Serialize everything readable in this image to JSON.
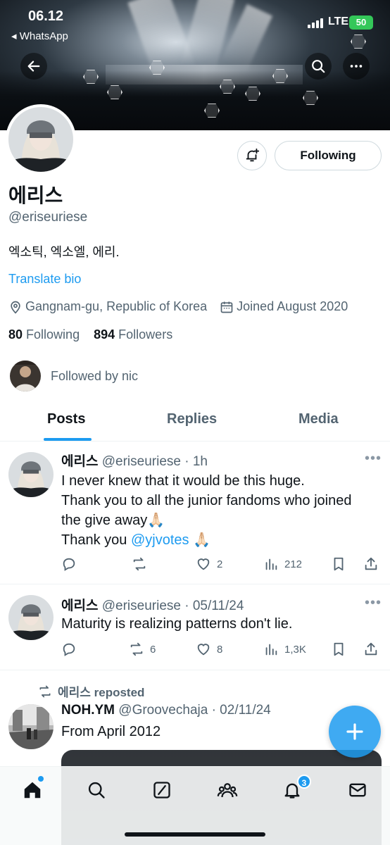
{
  "status_bar": {
    "time": "06.12",
    "back_app": "◂ WhatsApp",
    "network": "LTE",
    "battery": "50"
  },
  "profile": {
    "display_name": "에리스",
    "handle": "@eriseuriese",
    "bio": "엑소틱, 엑소엘, 에리.",
    "translate_label": "Translate bio",
    "location": "Gangnam-gu, Republic of Korea",
    "joined": "Joined August 2020",
    "following_count": "80",
    "following_label": "Following",
    "followers_count": "894",
    "followers_label": "Followers",
    "followed_by": "Followed by nic",
    "follow_button_label": "Following"
  },
  "tabs": [
    {
      "label": "Posts",
      "active": true
    },
    {
      "label": "Replies",
      "active": false
    },
    {
      "label": "Media",
      "active": false
    }
  ],
  "posts": [
    {
      "name": "에리스",
      "handle_time": "@eriseuriese · 1h",
      "lines": [
        "I never knew that it would be this huge.",
        "Thank you to all the junior fandoms who joined",
        "the give away🙏🏻"
      ],
      "line4_prefix": "Thank you ",
      "mention": "@yjvotes",
      "line4_suffix": " 🙏🏻",
      "replies": "",
      "reposts": "",
      "likes": "2",
      "views": "212"
    },
    {
      "name": "에리스",
      "handle_time": "@eriseuriese · 05/11/24",
      "text": "Maturity is realizing patterns don't lie.",
      "replies": "",
      "reposts": "6",
      "likes": "8",
      "views": "1,3K"
    },
    {
      "repost_label": "에리스 reposted",
      "name": "NOH.YM",
      "handle_time": "@Groovechaja · 02/11/24",
      "text": "From April 2012"
    }
  ],
  "bottom_nav": {
    "items": [
      "home-icon",
      "search-icon",
      "grok-icon",
      "communities-icon",
      "notifications-icon",
      "messages-icon"
    ],
    "notification_badge": "3"
  },
  "colors": {
    "accent": "#1d9bf0",
    "text": "#0f1419",
    "secondary": "#536471"
  }
}
